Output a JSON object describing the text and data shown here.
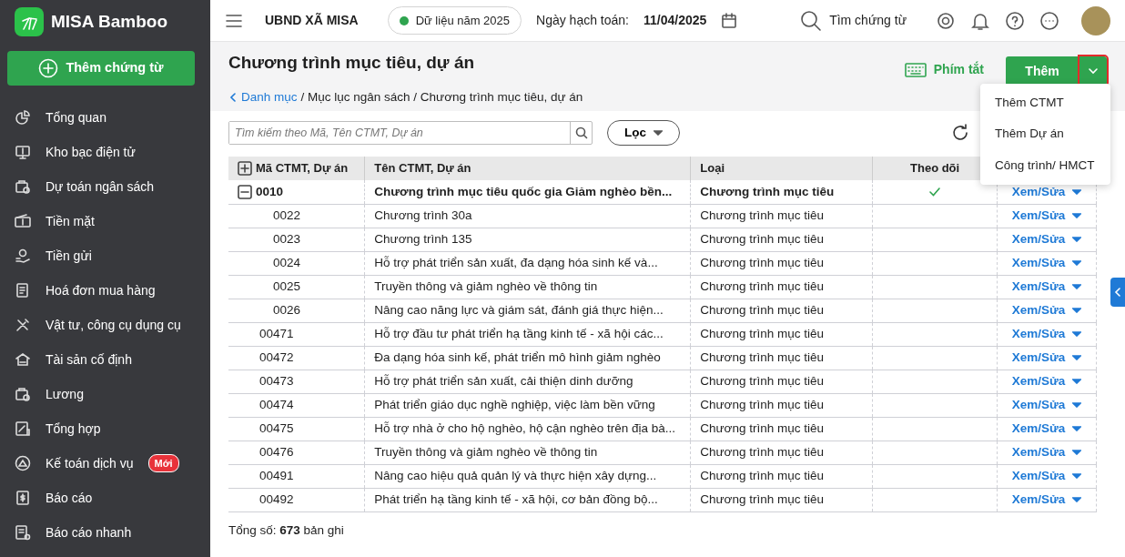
{
  "sidebar": {
    "brand": "MISA Bamboo",
    "add_button": "Thêm chứng từ",
    "items": [
      {
        "label": "Tổng quan"
      },
      {
        "label": "Kho bạc điện tử"
      },
      {
        "label": "Dự toán ngân sách"
      },
      {
        "label": "Tiền mặt"
      },
      {
        "label": "Tiền gửi"
      },
      {
        "label": "Hoá đơn mua hàng"
      },
      {
        "label": "Vật tư, công cụ dụng cụ"
      },
      {
        "label": "Tài sản cố định"
      },
      {
        "label": "Lương"
      },
      {
        "label": "Tổng hợp"
      },
      {
        "label": "Kế toán dịch vụ",
        "badge": "Mới"
      },
      {
        "label": "Báo cáo"
      },
      {
        "label": "Báo cáo nhanh"
      }
    ]
  },
  "topbar": {
    "org": "UBND XÃ MISA",
    "data_year": "Dữ liệu năm 2025",
    "date_label": "Ngày hạch toán:",
    "date": "11/04/2025",
    "search": "Tìm chứng từ"
  },
  "page": {
    "title": "Chương trình mục tiêu, dự án",
    "shortcut": "Phím tắt",
    "add_button": "Thêm",
    "add_toggle": {
      "highlighted": true
    },
    "add_menu": [
      "Thêm CTMT",
      "Thêm Dự án",
      "Công trình/ HMCT"
    ],
    "breadcrumb": {
      "link": "Danh mục",
      "path": "/ Mục lục ngân sách / Chương trình mục tiêu, dự án"
    }
  },
  "toolbar": {
    "search": {
      "placeholder": "Tìm kiếm theo Mã, Tên CTMT, Dự án"
    },
    "filter": "Lọc"
  },
  "table": {
    "columns": [
      "Mã CTMT, Dự án",
      "Tên CTMT, Dự án",
      "Loại",
      "Theo dõi"
    ],
    "rows": [
      {
        "code": "0010",
        "name": "Chương trình mục tiêu quốc gia Giảm nghèo bền...",
        "type": "Chương trình mục tiêu",
        "followed": true,
        "action": "Xem/Sửa",
        "expanded": true,
        "children": [
          {
            "code": "0022",
            "name": "Chương trình 30a",
            "type": "Chương trình mục tiêu",
            "followed": false,
            "action": "Xem/Sửa"
          },
          {
            "code": "0023",
            "name": "Chương trình 135",
            "type": "Chương trình mục tiêu",
            "followed": false,
            "action": "Xem/Sửa"
          },
          {
            "code": "0024",
            "name": "Hỗ trợ phát triển sản xuất, đa dạng hóa sinh kế và...",
            "type": "Chương trình mục tiêu",
            "followed": false,
            "action": "Xem/Sửa"
          },
          {
            "code": "0025",
            "name": "Truyền thông và giảm nghèo về thông tin",
            "type": "Chương trình mục tiêu",
            "followed": false,
            "action": "Xem/Sửa"
          },
          {
            "code": "0026",
            "name": "Nâng cao năng lực và giám sát, đánh giá thực hiện...",
            "type": "Chương trình mục tiêu",
            "followed": false,
            "action": "Xem/Sửa"
          }
        ]
      },
      {
        "code": "00471",
        "name": "Hỗ trợ đầu tư phát triển hạ tầng kinh tế - xã hội các...",
        "type": "Chương trình mục tiêu",
        "followed": false,
        "action": "Xem/Sửa"
      },
      {
        "code": "00472",
        "name": "Đa dạng hóa sinh kế, phát triển mô hình giảm nghèo",
        "type": "Chương trình mục tiêu",
        "followed": false,
        "action": "Xem/Sửa"
      },
      {
        "code": "00473",
        "name": "Hỗ trợ phát triển sản xuất, cải thiện dinh dưỡng",
        "type": "Chương trình mục tiêu",
        "followed": false,
        "action": "Xem/Sửa"
      },
      {
        "code": "00474",
        "name": "Phát triển giáo dục nghề nghiệp, việc làm bền vững",
        "type": "Chương trình mục tiêu",
        "followed": false,
        "action": "Xem/Sửa"
      },
      {
        "code": "00475",
        "name": "Hỗ trợ nhà ở cho hộ nghèo, hộ cận nghèo trên địa bà...",
        "type": "Chương trình mục tiêu",
        "followed": false,
        "action": "Xem/Sửa"
      },
      {
        "code": "00476",
        "name": "Truyền thông và giảm nghèo về thông tin",
        "type": "Chương trình mục tiêu",
        "followed": false,
        "action": "Xem/Sửa"
      },
      {
        "code": "00491",
        "name": "Nâng cao hiệu quả quản lý và thực hiện xây dựng...",
        "type": "Chương trình mục tiêu",
        "followed": false,
        "action": "Xem/Sửa"
      },
      {
        "code": "00492",
        "name": "Phát triển hạ tầng kinh tế - xã hội, cơ bản đồng bộ...",
        "type": "Chương trình mục tiêu",
        "followed": false,
        "action": "Xem/Sửa"
      }
    ]
  },
  "footer": {
    "total": "Tổng số: **673** bản ghi"
  }
}
